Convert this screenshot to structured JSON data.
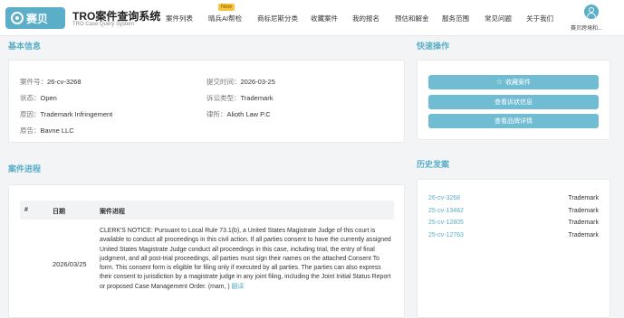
{
  "header": {
    "logo_text": "赛贝",
    "title": "TRO案件查询系统",
    "subtitle": "TRO Case Query System",
    "nav": [
      "案件列表",
      "晴兵AI帮检",
      "商标尼斯分类",
      "收藏案件",
      "我的报名",
      "预估和解金",
      "服务范围",
      "常见问题",
      "关于我们"
    ],
    "new_badge": "New",
    "user_name": "赛贝跨境和..."
  },
  "basic_info": {
    "title": "基本信息",
    "case_no_label": "案件号：",
    "case_no": "26-cv-3268",
    "filed_label": "提交时间：",
    "filed": "2026-03-25",
    "status_label": "状态：",
    "status": "Open",
    "type_label": "诉讼类型：",
    "type": "Trademark",
    "cause_label": "原因：",
    "cause": "Trademark Infringement",
    "firm_label": "律所：",
    "firm": "Alioth Law P.C",
    "plaintiff_label": "原告：",
    "plaintiff": "Bavne LLC"
  },
  "quick_actions": {
    "title": "快速操作",
    "favorite": "收藏案件",
    "view_lawsuit": "查看诉状信息",
    "view_brand": "查看品牌详情"
  },
  "history": {
    "title": "历史发案",
    "items": [
      {
        "case": "26-cv-3268",
        "type": "Trademark"
      },
      {
        "case": "25-cv-13482",
        "type": "Trademark"
      },
      {
        "case": "25-cv-12805",
        "type": "Trademark"
      },
      {
        "case": "25-cv-12763",
        "type": "Trademark"
      }
    ]
  },
  "progress": {
    "title": "案件进程",
    "col_num": "#",
    "col_date": "日期",
    "col_progress": "案件进程",
    "date": "2026/03/25",
    "notice": "CLERK'S NOTICE: Pursuant to Local Rule 73.1(b), a United States Magistrate Judge of this court is available to conduct all proceedings in this civil action. If all parties consent to have the currently assigned United States Magistrate Judge conduct all proceedings in this case, including trial, the entry of final judgment, and all post-trial proceedings, all parties must sign their names on the attached Consent To form. This consent form is eligible for filing only if executed by all parties. The parties can also express their consent to jurisdiction by a magistrate judge in any joint filing, including the Joint Initial Status Report or proposed Case Management Order. (mam, )",
    "translate": "翻译"
  },
  "colors": {
    "accent": "#5aaec7",
    "button": "#6fbcd3",
    "badge": "#f7c53a"
  }
}
